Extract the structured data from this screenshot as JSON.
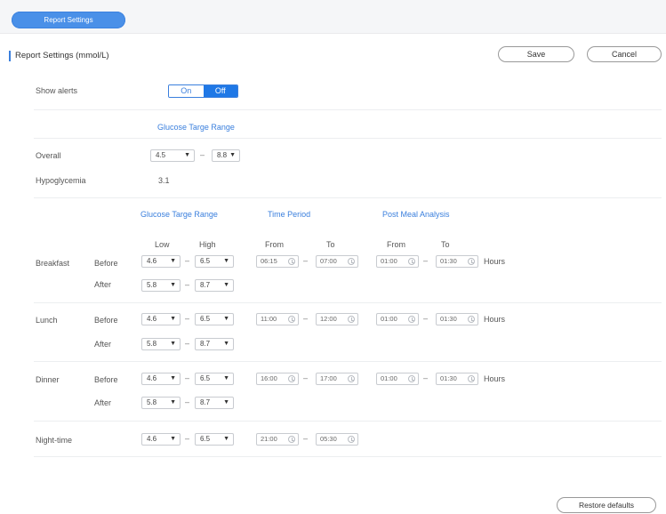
{
  "tab": {
    "label": "Report Settings"
  },
  "page": {
    "title": "Report Settings (mmol/L)"
  },
  "actions": {
    "save": "Save",
    "cancel": "Cancel",
    "restore": "Restore defaults"
  },
  "alerts": {
    "label": "Show alerts",
    "on": "On",
    "off": "Off",
    "selected": "Off"
  },
  "overall_section": {
    "heading": "Glucose Targe Range",
    "overall_label": "Overall",
    "overall_low": "4.5",
    "overall_high": "8.8",
    "hypo_label": "Hypoglycemia",
    "hypo_value": "3.1"
  },
  "meals_section": {
    "headings": {
      "range": "Glucose Targe Range",
      "period": "Time Period",
      "post_meal": "Post Meal Analysis"
    },
    "subheadings": {
      "low": "Low",
      "high": "High",
      "from": "From",
      "to": "To",
      "from2": "From",
      "to2": "To"
    },
    "hours": "Hours",
    "before_label": "Before",
    "after_label": "After",
    "meals": [
      {
        "name": "Breakfast",
        "before": {
          "low": "4.6",
          "high": "6.5"
        },
        "after": {
          "low": "5.8",
          "high": "8.7"
        },
        "period": {
          "from": "06:15",
          "to": "07:00"
        },
        "post": {
          "from": "01:00",
          "to": "01:30"
        }
      },
      {
        "name": "Lunch",
        "before": {
          "low": "4.6",
          "high": "6.5"
        },
        "after": {
          "low": "5.8",
          "high": "8.7"
        },
        "period": {
          "from": "11:00",
          "to": "12:00"
        },
        "post": {
          "from": "01:00",
          "to": "01:30"
        }
      },
      {
        "name": "Dinner",
        "before": {
          "low": "4.6",
          "high": "6.5"
        },
        "after": {
          "low": "5.8",
          "high": "8.7"
        },
        "period": {
          "from": "16:00",
          "to": "17:00"
        },
        "post": {
          "from": "01:00",
          "to": "01:30"
        }
      }
    ],
    "night": {
      "name": "Night-time",
      "range": {
        "low": "4.6",
        "high": "6.5"
      },
      "period": {
        "from": "21:00",
        "to": "05:30"
      }
    }
  },
  "colors": {
    "accent": "#1f78e6",
    "tab": "#4a90e8",
    "heading": "#3a7fdd"
  }
}
